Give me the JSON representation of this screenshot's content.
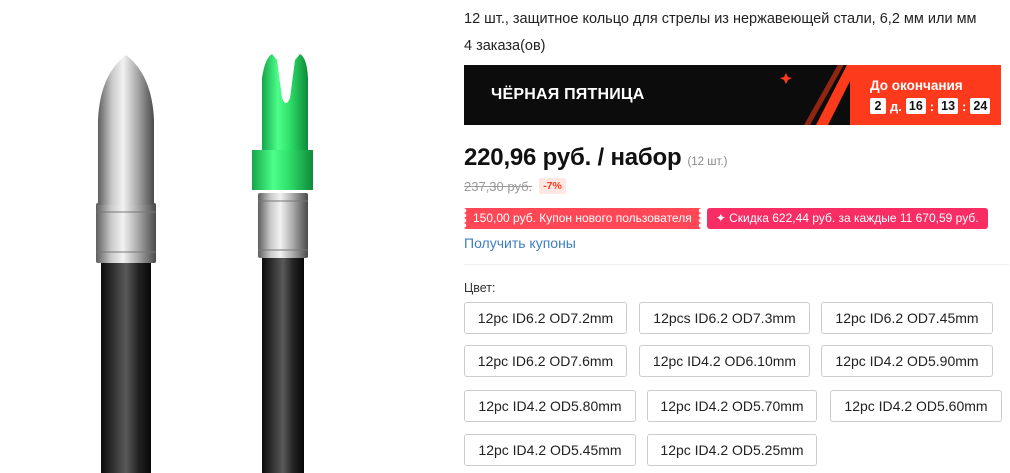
{
  "product": {
    "title": "12 шт., защитное кольцо для стрелы из нержавеющей стали, 6,2 мм или мм",
    "orders": "4 заказа(ов)"
  },
  "promo": {
    "title": "ЧЁРНАЯ ПЯТНИЦА",
    "countdown_label": "До окончания",
    "days": "2",
    "days_unit": "д.",
    "hours": "16",
    "minutes": "13",
    "seconds": "24",
    "banner_color": "#0c0c0c",
    "countdown_color": "#fd3a1b"
  },
  "price": {
    "current": "220,96 руб. / набор",
    "quantity_note": "(12 шт.)",
    "old": "237,30 руб.",
    "discount": "-7%"
  },
  "coupons": {
    "new_user": "150,00 руб. Купон нового пользователя",
    "discount": "✦ Скидка 622,44 руб. за каждые 11 670,59 руб.",
    "get_link": "Получить купоны"
  },
  "color_section": {
    "label": "Цвет:",
    "options": [
      "12pc ID6.2 OD7.2mm",
      "12pcs ID6.2 OD7.3mm",
      "12pc ID6.2 OD7.45mm",
      "12pc ID6.2 OD7.6mm",
      "12pc ID4.2 OD6.10mm",
      "12pc ID4.2 OD5.90mm",
      "12pc ID4.2 OD5.80mm",
      "12pc ID4.2 OD5.70mm",
      "12pc ID4.2 OD5.60mm",
      "12pc ID4.2 OD5.45mm",
      "12pc ID4.2 OD5.25mm"
    ]
  },
  "colors": {
    "accent_red": "#fd3a1b",
    "coupon_red": "#ff4755",
    "coupon_pink": "#f72d64",
    "link_blue": "#3e7ec2",
    "nock_green": "#2fe06a"
  }
}
